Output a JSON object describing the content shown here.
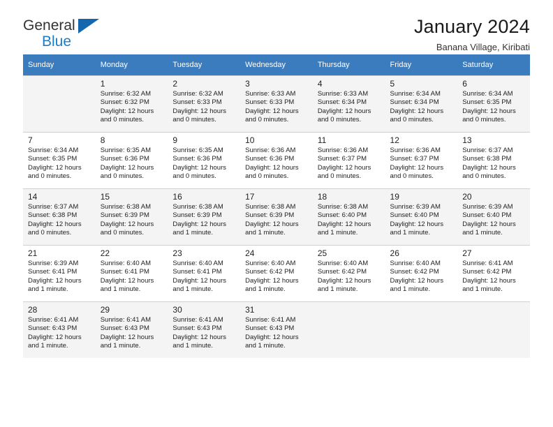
{
  "brand": {
    "name_top": "General",
    "name_bottom": "Blue",
    "accent_color": "#1567ad"
  },
  "header": {
    "title": "January 2024",
    "subtitle": "Banana Village, Kiribati"
  },
  "calendar": {
    "header_color": "#3a7cbe",
    "weekday_headers": [
      "Sunday",
      "Monday",
      "Tuesday",
      "Wednesday",
      "Thursday",
      "Friday",
      "Saturday"
    ],
    "weeks": [
      [
        {
          "day": "",
          "sunrise": "",
          "sunset": "",
          "daylight": ""
        },
        {
          "day": "1",
          "sunrise": "Sunrise: 6:32 AM",
          "sunset": "Sunset: 6:32 PM",
          "daylight": "Daylight: 12 hours and 0 minutes."
        },
        {
          "day": "2",
          "sunrise": "Sunrise: 6:32 AM",
          "sunset": "Sunset: 6:33 PM",
          "daylight": "Daylight: 12 hours and 0 minutes."
        },
        {
          "day": "3",
          "sunrise": "Sunrise: 6:33 AM",
          "sunset": "Sunset: 6:33 PM",
          "daylight": "Daylight: 12 hours and 0 minutes."
        },
        {
          "day": "4",
          "sunrise": "Sunrise: 6:33 AM",
          "sunset": "Sunset: 6:34 PM",
          "daylight": "Daylight: 12 hours and 0 minutes."
        },
        {
          "day": "5",
          "sunrise": "Sunrise: 6:34 AM",
          "sunset": "Sunset: 6:34 PM",
          "daylight": "Daylight: 12 hours and 0 minutes."
        },
        {
          "day": "6",
          "sunrise": "Sunrise: 6:34 AM",
          "sunset": "Sunset: 6:35 PM",
          "daylight": "Daylight: 12 hours and 0 minutes."
        }
      ],
      [
        {
          "day": "7",
          "sunrise": "Sunrise: 6:34 AM",
          "sunset": "Sunset: 6:35 PM",
          "daylight": "Daylight: 12 hours and 0 minutes."
        },
        {
          "day": "8",
          "sunrise": "Sunrise: 6:35 AM",
          "sunset": "Sunset: 6:36 PM",
          "daylight": "Daylight: 12 hours and 0 minutes."
        },
        {
          "day": "9",
          "sunrise": "Sunrise: 6:35 AM",
          "sunset": "Sunset: 6:36 PM",
          "daylight": "Daylight: 12 hours and 0 minutes."
        },
        {
          "day": "10",
          "sunrise": "Sunrise: 6:36 AM",
          "sunset": "Sunset: 6:36 PM",
          "daylight": "Daylight: 12 hours and 0 minutes."
        },
        {
          "day": "11",
          "sunrise": "Sunrise: 6:36 AM",
          "sunset": "Sunset: 6:37 PM",
          "daylight": "Daylight: 12 hours and 0 minutes."
        },
        {
          "day": "12",
          "sunrise": "Sunrise: 6:36 AM",
          "sunset": "Sunset: 6:37 PM",
          "daylight": "Daylight: 12 hours and 0 minutes."
        },
        {
          "day": "13",
          "sunrise": "Sunrise: 6:37 AM",
          "sunset": "Sunset: 6:38 PM",
          "daylight": "Daylight: 12 hours and 0 minutes."
        }
      ],
      [
        {
          "day": "14",
          "sunrise": "Sunrise: 6:37 AM",
          "sunset": "Sunset: 6:38 PM",
          "daylight": "Daylight: 12 hours and 0 minutes."
        },
        {
          "day": "15",
          "sunrise": "Sunrise: 6:38 AM",
          "sunset": "Sunset: 6:39 PM",
          "daylight": "Daylight: 12 hours and 0 minutes."
        },
        {
          "day": "16",
          "sunrise": "Sunrise: 6:38 AM",
          "sunset": "Sunset: 6:39 PM",
          "daylight": "Daylight: 12 hours and 1 minute."
        },
        {
          "day": "17",
          "sunrise": "Sunrise: 6:38 AM",
          "sunset": "Sunset: 6:39 PM",
          "daylight": "Daylight: 12 hours and 1 minute."
        },
        {
          "day": "18",
          "sunrise": "Sunrise: 6:38 AM",
          "sunset": "Sunset: 6:40 PM",
          "daylight": "Daylight: 12 hours and 1 minute."
        },
        {
          "day": "19",
          "sunrise": "Sunrise: 6:39 AM",
          "sunset": "Sunset: 6:40 PM",
          "daylight": "Daylight: 12 hours and 1 minute."
        },
        {
          "day": "20",
          "sunrise": "Sunrise: 6:39 AM",
          "sunset": "Sunset: 6:40 PM",
          "daylight": "Daylight: 12 hours and 1 minute."
        }
      ],
      [
        {
          "day": "21",
          "sunrise": "Sunrise: 6:39 AM",
          "sunset": "Sunset: 6:41 PM",
          "daylight": "Daylight: 12 hours and 1 minute."
        },
        {
          "day": "22",
          "sunrise": "Sunrise: 6:40 AM",
          "sunset": "Sunset: 6:41 PM",
          "daylight": "Daylight: 12 hours and 1 minute."
        },
        {
          "day": "23",
          "sunrise": "Sunrise: 6:40 AM",
          "sunset": "Sunset: 6:41 PM",
          "daylight": "Daylight: 12 hours and 1 minute."
        },
        {
          "day": "24",
          "sunrise": "Sunrise: 6:40 AM",
          "sunset": "Sunset: 6:42 PM",
          "daylight": "Daylight: 12 hours and 1 minute."
        },
        {
          "day": "25",
          "sunrise": "Sunrise: 6:40 AM",
          "sunset": "Sunset: 6:42 PM",
          "daylight": "Daylight: 12 hours and 1 minute."
        },
        {
          "day": "26",
          "sunrise": "Sunrise: 6:40 AM",
          "sunset": "Sunset: 6:42 PM",
          "daylight": "Daylight: 12 hours and 1 minute."
        },
        {
          "day": "27",
          "sunrise": "Sunrise: 6:41 AM",
          "sunset": "Sunset: 6:42 PM",
          "daylight": "Daylight: 12 hours and 1 minute."
        }
      ],
      [
        {
          "day": "28",
          "sunrise": "Sunrise: 6:41 AM",
          "sunset": "Sunset: 6:43 PM",
          "daylight": "Daylight: 12 hours and 1 minute."
        },
        {
          "day": "29",
          "sunrise": "Sunrise: 6:41 AM",
          "sunset": "Sunset: 6:43 PM",
          "daylight": "Daylight: 12 hours and 1 minute."
        },
        {
          "day": "30",
          "sunrise": "Sunrise: 6:41 AM",
          "sunset": "Sunset: 6:43 PM",
          "daylight": "Daylight: 12 hours and 1 minute."
        },
        {
          "day": "31",
          "sunrise": "Sunrise: 6:41 AM",
          "sunset": "Sunset: 6:43 PM",
          "daylight": "Daylight: 12 hours and 1 minute."
        },
        {
          "day": "",
          "sunrise": "",
          "sunset": "",
          "daylight": ""
        },
        {
          "day": "",
          "sunrise": "",
          "sunset": "",
          "daylight": ""
        },
        {
          "day": "",
          "sunrise": "",
          "sunset": "",
          "daylight": ""
        }
      ]
    ]
  }
}
